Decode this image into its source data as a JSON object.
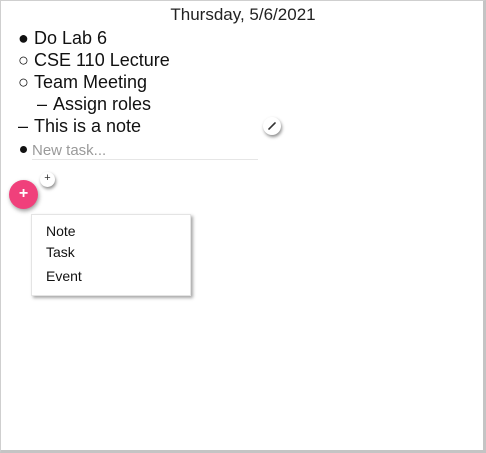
{
  "header": {
    "date": "Thursday, 5/6/2021"
  },
  "entries": [
    {
      "bullet": "●",
      "text": "Do Lab 6"
    },
    {
      "bullet": "○",
      "text": "CSE 110 Lecture"
    },
    {
      "bullet": "○",
      "text": "Team Meeting"
    },
    {
      "bullet": "–",
      "text": "Assign roles"
    },
    {
      "bullet": "–",
      "text": "This is a note"
    }
  ],
  "new_task": {
    "placeholder": "New task...",
    "value": ""
  },
  "add_menu": {
    "fab_label": "+",
    "small_add_label": "+",
    "items": [
      "Note",
      "Task",
      "Event"
    ]
  },
  "icons": {
    "edit": "pencil-icon",
    "add": "plus-icon",
    "accent_color": "#f0407b"
  }
}
